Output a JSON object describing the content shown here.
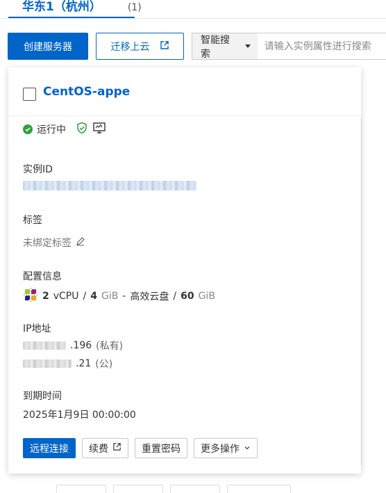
{
  "region_tab": {
    "name": "华东1（杭州）",
    "count": "(1)"
  },
  "toolbar": {
    "create_label": "创建服务器",
    "migrate_label": "迁移上云",
    "search_select_label": "智能搜索",
    "search_placeholder": "请输入实例属性进行搜索"
  },
  "instance": {
    "name": "CentOS-appe",
    "status": "运行中",
    "status_color": "#2fa13d",
    "instance_id_label": "实例ID",
    "tags_label": "标签",
    "tags_value": "未绑定标签",
    "config_label": "配置信息",
    "config": {
      "vcpu_num": "2",
      "vcpu_unit": "vCPU",
      "sep1": "/",
      "mem_num": "4",
      "mem_unit": "GiB",
      "dash": "-",
      "disk_type": "高效云盘",
      "sep2": "/",
      "disk_num": "60",
      "disk_unit": "GiB"
    },
    "ip_label": "IP地址",
    "private_ip_suffix": ".196",
    "private_tag": "(私有)",
    "public_ip_suffix": ".21",
    "public_tag": "(公)",
    "expire_label": "到期时间",
    "expire_value": "2025年1月9日 00:00:00"
  },
  "actions": {
    "remote": "远程连接",
    "renew": "续费",
    "reset_pwd": "重置密码",
    "more": "更多操作"
  },
  "colors": {
    "primary": "#0064c8"
  }
}
